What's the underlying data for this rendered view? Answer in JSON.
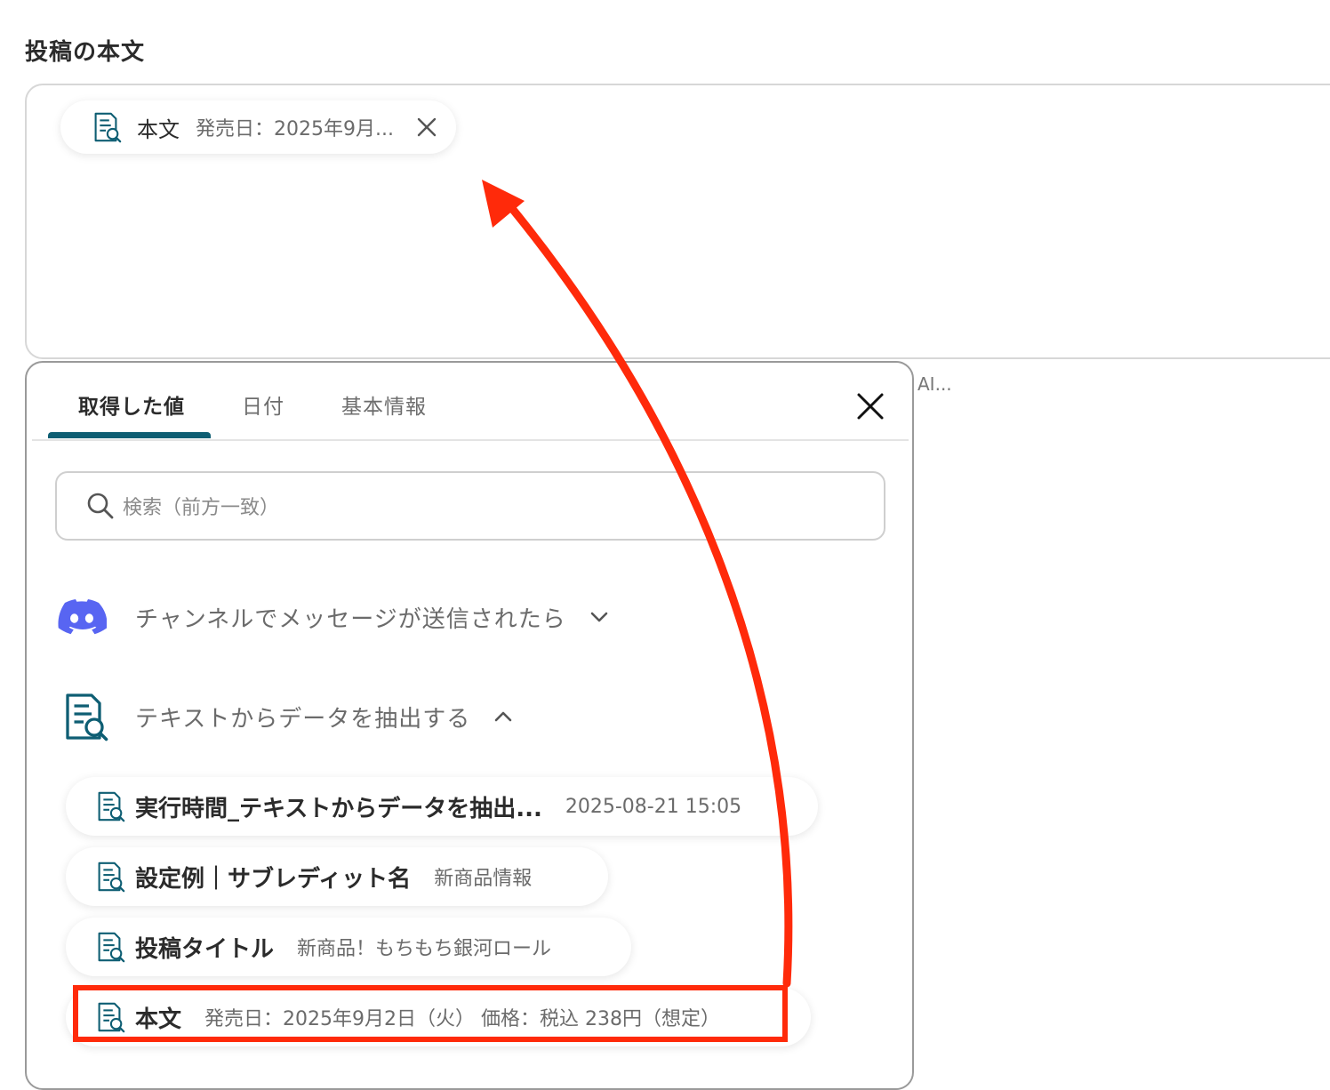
{
  "section": {
    "title": "投稿の本文"
  },
  "token": {
    "label": "本文",
    "value": "発売日：2025年9月..."
  },
  "ai_hint": "AI...",
  "panel": {
    "tabs": [
      {
        "label": "取得した値"
      },
      {
        "label": "日付"
      },
      {
        "label": "基本情報"
      }
    ],
    "search_placeholder": "検索（前方一致）",
    "groups": [
      {
        "title": "チャンネルでメッセージが送信されたら"
      },
      {
        "title": "テキストからデータを抽出する"
      }
    ],
    "items": [
      {
        "label": "実行時間_テキストからデータを抽出...",
        "value": "2025-08-21 15:05"
      },
      {
        "label": "設定例｜サブレディット名",
        "value": "新商品情報"
      },
      {
        "label": "投稿タイトル",
        "value": "新商品！もちもち銀河ロール"
      },
      {
        "label": "本文",
        "value": "発売日：2025年9月2日（火） 価格：税込 238円（想定）"
      }
    ]
  },
  "colors": {
    "accent": "#0e5e73",
    "discord": "#5865f2",
    "annotation": "#ff2a0a"
  },
  "icons": [
    "document-search-icon",
    "close-icon",
    "search-icon",
    "discord-icon",
    "chevron-down-icon",
    "chevron-up-icon"
  ]
}
